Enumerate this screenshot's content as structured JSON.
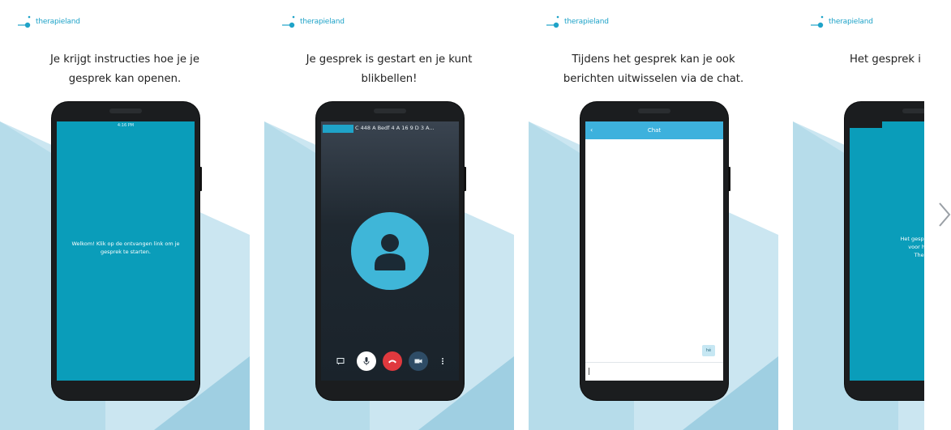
{
  "brand": {
    "logo_text": "therapieland",
    "accent": "#1fa3c8",
    "screen_teal": "#0a9dba",
    "light_blue": "#a9d5e6"
  },
  "cards": [
    {
      "caption_line1": "Je krijgt instructies hoe je je",
      "caption_line2": "gesprek kan openen.",
      "status_time": "4:16 PM",
      "welcome_text": "Welkom! Klik op de ontvangen link om je gesprek te starten."
    },
    {
      "caption_line1": "Je gesprek is gestart en je kunt",
      "caption_line2": "blikbellen!",
      "room_label": "C 448 A Bedf 4 A 16 9 D 3 A...",
      "icons": [
        "chat-icon",
        "microphone-icon",
        "hangup-icon",
        "camera-icon",
        "more-icon"
      ]
    },
    {
      "caption_line1": "Tijdens het gesprek kan je ook",
      "caption_line2": "berichten uitwisselen via de chat.",
      "chat_title": "Chat",
      "back_glyph": "‹",
      "bubble_text": "hé"
    },
    {
      "caption_line1": "Het gesprek i",
      "caption_line2": "",
      "message_lines": [
        "Het gesprek is be",
        "voor het ge",
        "Therap"
      ]
    }
  ],
  "navigation": {
    "next_icon": "chevron-right-icon"
  }
}
